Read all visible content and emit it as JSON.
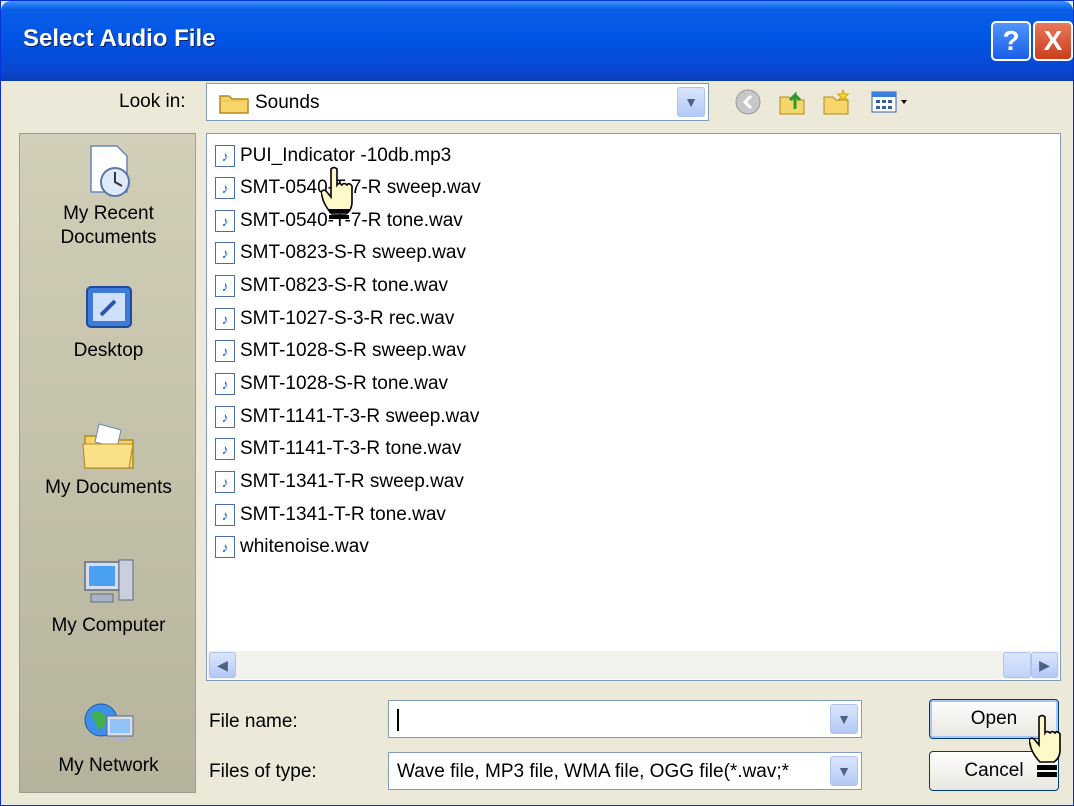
{
  "window": {
    "title": "Select Audio File"
  },
  "title_buttons": {
    "help": "?",
    "close": "X"
  },
  "look_in": {
    "label": "Look in:",
    "value": "Sounds"
  },
  "places": [
    {
      "name": "recent",
      "label_lines": [
        "My Recent",
        "Documents"
      ]
    },
    {
      "name": "desktop",
      "label_lines": [
        "Desktop"
      ]
    },
    {
      "name": "documents",
      "label_lines": [
        "My Documents"
      ]
    },
    {
      "name": "computer",
      "label_lines": [
        "My Computer"
      ]
    },
    {
      "name": "network",
      "label_lines": [
        "My Network"
      ]
    }
  ],
  "files": [
    "PUI_Indicator -10db.mp3",
    "SMT-0540-T-7-R sweep.wav",
    "SMT-0540-T-7-R tone.wav",
    "SMT-0823-S-R sweep.wav",
    "SMT-0823-S-R tone.wav",
    "SMT-1027-S-3-R rec.wav",
    "SMT-1028-S-R sweep.wav",
    "SMT-1028-S-R tone.wav",
    "SMT-1141-T-3-R sweep.wav",
    "SMT-1141-T-3-R tone.wav",
    "SMT-1341-T-R sweep.wav",
    "SMT-1341-T-R tone.wav",
    "whitenoise.wav"
  ],
  "file_name": {
    "label": "File name:",
    "value": ""
  },
  "file_type": {
    "label": "Files of type:",
    "value": "Wave file, MP3 file, WMA file, OGG file(*.wav;*"
  },
  "buttons": {
    "open": "Open",
    "cancel": "Cancel"
  },
  "colors": {
    "titlebar": "#0055e5",
    "dialog_bg": "#ece9d8",
    "places_bg": "#c4c1aa"
  }
}
